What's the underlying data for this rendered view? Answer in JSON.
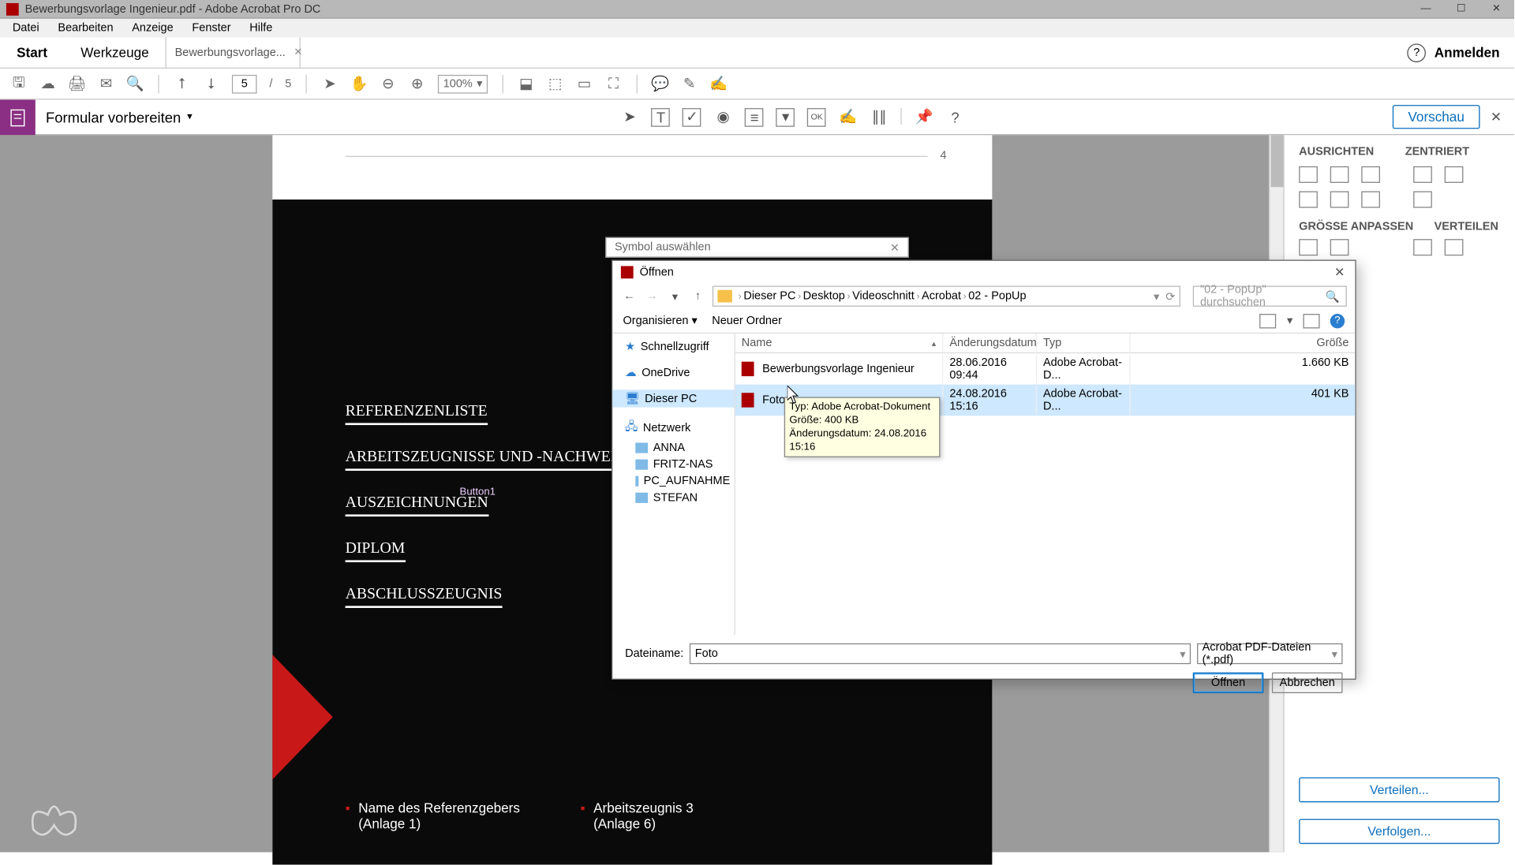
{
  "titlebar": {
    "text": "Bewerbungsvorlage Ingenieur.pdf - Adobe Acrobat Pro DC"
  },
  "menubar": [
    "Datei",
    "Bearbeiten",
    "Anzeige",
    "Fenster",
    "Hilfe"
  ],
  "tabs": {
    "start": "Start",
    "tools": "Werkzeuge",
    "doc": "Bewerbungsvorlage..."
  },
  "signin": "Anmelden",
  "toolbar": {
    "page_current": "5",
    "page_sep": "/",
    "page_total": "5",
    "zoom": "100%"
  },
  "formbar": {
    "title": "Formular vorbereiten",
    "preview": "Vorschau"
  },
  "doc": {
    "page_num": "4",
    "h1": "REFERENZENLISTE",
    "h2": "ARBEITSZEUGNISSE UND -NACHWEISE",
    "h3": "AUSZEICHNUNGEN",
    "h3_btn": "Button1",
    "h4": "DIPLOM",
    "h5": "ABSCHLUSSZEUGNIS",
    "b1a": "Name des Referenzgebers",
    "b1b": "(Anlage 1)",
    "b2a": "Arbeitszeugnis 3",
    "b2b": "(Anlage 6)"
  },
  "rightpanel": {
    "align": "AUSRICHTEN",
    "center": "ZENTRIERT",
    "size": "GRÖSSE ANPASSEN",
    "distribute": "VERTEILEN",
    "btn_distribute": "Verteilen...",
    "btn_track": "Verfolgen..."
  },
  "sym_dialog": {
    "title": "Symbol auswählen"
  },
  "open_dialog": {
    "title": "Öffnen",
    "breadcrumb": [
      "Dieser PC",
      "Desktop",
      "Videoschnitt",
      "Acrobat",
      "02 - PopUp"
    ],
    "search_placeholder": "\"02 - PopUp\" durchsuchen",
    "organize": "Organisieren",
    "new_folder": "Neuer Ordner",
    "tree": {
      "quick": "Schnellzugriff",
      "onedrive": "OneDrive",
      "this_pc": "Dieser PC",
      "network": "Netzwerk",
      "nodes": [
        "ANNA",
        "FRITZ-NAS",
        "PC_AUFNAHME",
        "STEFAN"
      ]
    },
    "columns": {
      "name": "Name",
      "date": "Änderungsdatum",
      "type": "Typ",
      "size": "Größe"
    },
    "files": [
      {
        "name": "Bewerbungsvorlage Ingenieur",
        "date": "28.06.2016 09:44",
        "type": "Adobe Acrobat-D...",
        "size": "1.660 KB"
      },
      {
        "name": "Foto",
        "date": "24.08.2016 15:16",
        "type": "Adobe Acrobat-D...",
        "size": "401 KB"
      }
    ],
    "tooltip": {
      "l1": "Typ: Adobe Acrobat-Dokument",
      "l2": "Größe: 400 KB",
      "l3": "Änderungsdatum: 24.08.2016 15:16"
    },
    "filename_label": "Dateiname:",
    "filename_value": "Foto",
    "filter": "Acrobat PDF-Dateien (*.pdf)",
    "btn_open": "Öffnen",
    "btn_cancel": "Abbrechen"
  }
}
